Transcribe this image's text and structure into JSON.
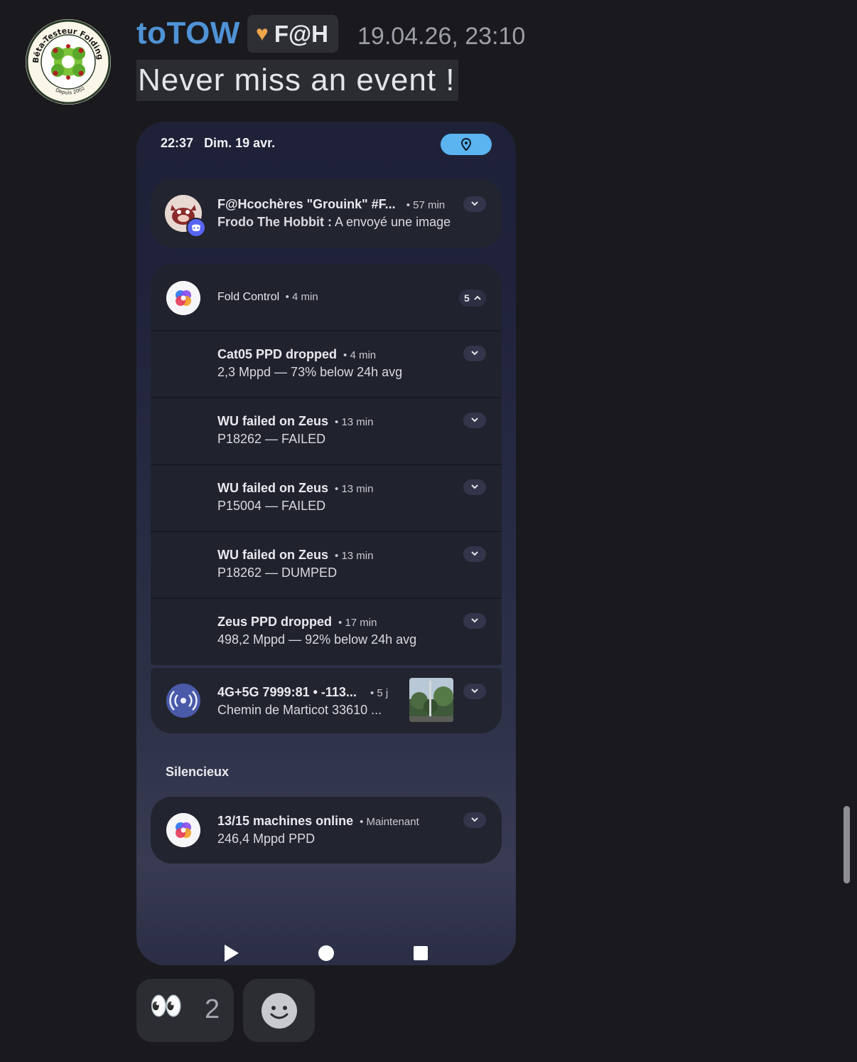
{
  "message": {
    "author": "toTOW",
    "guild_tag": "F@H",
    "guild_tag_icon": "heart-icon",
    "timestamp": "19.04.26, 23:10",
    "text": "Never miss an event !",
    "avatar_text_top": "Bêta-Testeur Folding@home",
    "avatar_text_bottom": "Depuis 2002"
  },
  "phone": {
    "status_time": "22:37",
    "status_date": "Dim. 19 avr.",
    "status_icon": "location-pin-icon",
    "notifications": [
      {
        "id": "discord",
        "title": "F@Hcochères \"Grouink\" #F...",
        "meta": "• 57 min",
        "subtitle_bold": "Frodo The Hobbit :",
        "subtitle": "A envoyé une image"
      }
    ],
    "group": {
      "app": "Fold Control",
      "meta": "• 4 min",
      "count": "5",
      "items": [
        {
          "title": "Cat05 PPD dropped",
          "meta": "• 4 min",
          "body": "2,3 Mppd — 73% below 24h avg"
        },
        {
          "title": "WU failed on Zeus",
          "meta": "• 13 min",
          "body": "P18262 — FAILED"
        },
        {
          "title": "WU failed on Zeus",
          "meta": "• 13 min",
          "body": "P15004 — FAILED"
        },
        {
          "title": "WU failed on Zeus",
          "meta": "• 13 min",
          "body": "P18262 — DUMPED"
        },
        {
          "title": "Zeus PPD dropped",
          "meta": "• 17 min",
          "body": "498,2 Mppd — 92% below 24h avg"
        }
      ]
    },
    "cell": {
      "title": "4G+5G 7999:81 • -113...",
      "meta": "• 5 j",
      "body": "Chemin de Marticot 33610 ..."
    },
    "silent_label": "Silencieux",
    "silent": {
      "title": "13/15 machines online",
      "meta": "• Maintenant",
      "body": "246,4 Mppd PPD"
    },
    "nav": [
      "back-icon",
      "home-icon",
      "recents-icon"
    ]
  },
  "reactions": [
    {
      "emoji": "👀",
      "count": "2"
    },
    {
      "emoji": "add-reaction-icon",
      "count": ""
    }
  ],
  "colors": {
    "author": "#4f93d6",
    "accent_pill": "#5bb4ef",
    "background": "#1a1a1e"
  }
}
